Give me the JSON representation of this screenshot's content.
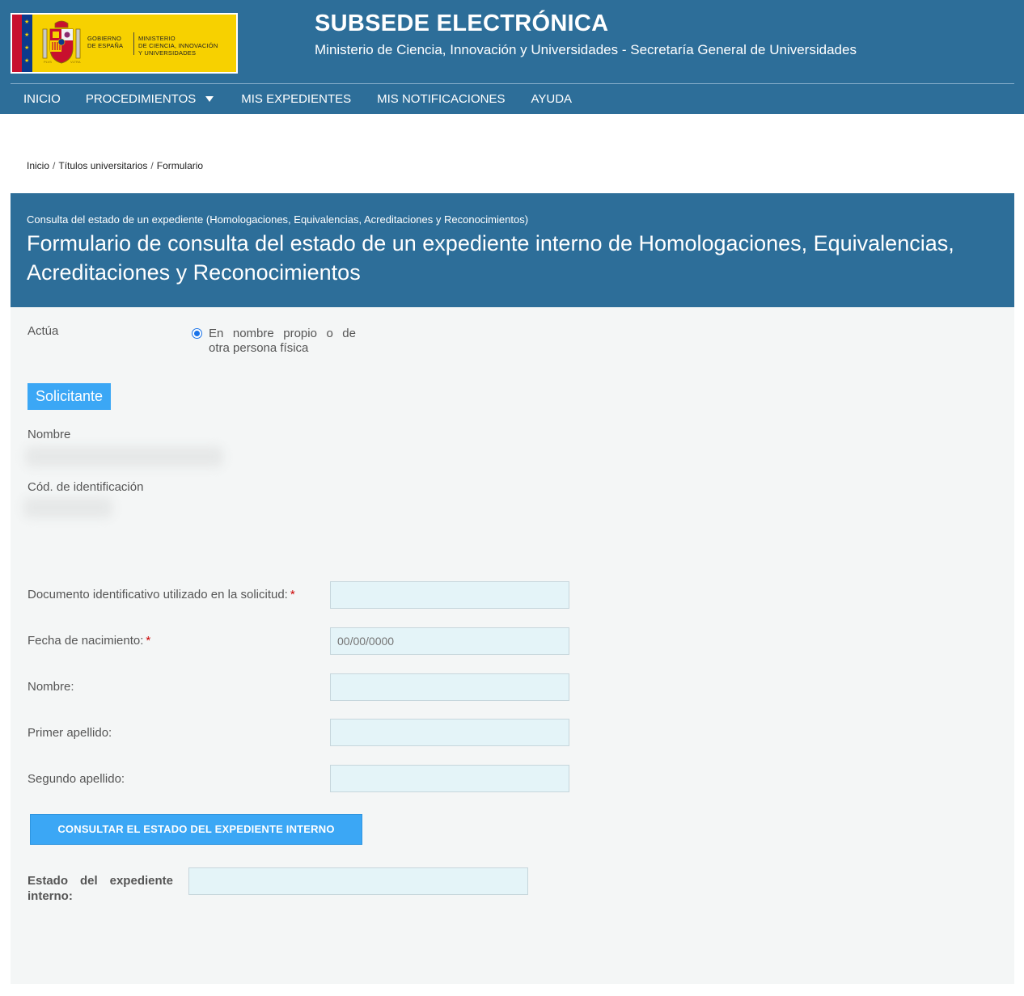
{
  "header": {
    "logo_left_text": [
      "GOBIERNO",
      "DE ESPAÑA"
    ],
    "logo_right_text": [
      "MINISTERIO",
      "DE CIENCIA, INNOVACIÓN",
      "Y UNIVERSIDADES"
    ],
    "title": "SUBSEDE ELECTRÓNICA",
    "subtitle": "Ministerio de Ciencia, Innovación y Universidades - Secretaría General de Universidades"
  },
  "nav": {
    "items": [
      {
        "label": "INICIO"
      },
      {
        "label": "PROCEDIMIENTOS",
        "dropdown": true
      },
      {
        "label": "MIS EXPEDIENTES"
      },
      {
        "label": "MIS NOTIFICACIONES"
      },
      {
        "label": "AYUDA"
      }
    ]
  },
  "breadcrumb": {
    "items": [
      "Inicio",
      "Títulos universitarios",
      "Formulario"
    ],
    "separator": "/"
  },
  "banner": {
    "small": "Consulta del estado de un expediente (Homologaciones, Equivalencias, Acreditaciones y Reconocimientos)",
    "title": "Formulario de consulta del estado de un expediente interno de Homologaciones, Equivalencias, Acreditaciones y Reconocimientos"
  },
  "form": {
    "actua_label": "Actúa",
    "actua_option": "En nombre propio o de otra persona física",
    "section_label": "Solicitante",
    "nombre_label": "Nombre",
    "cod_label": "Cód. de identificación",
    "fields": {
      "documento": {
        "label": "Documento identificativo utilizado en la solicitud:",
        "required_mark": "*",
        "value": ""
      },
      "fecha": {
        "label": "Fecha de nacimiento:",
        "required_mark": "*",
        "placeholder": "00/00/0000"
      },
      "nombre": {
        "label": "Nombre:",
        "value": ""
      },
      "primer_apellido": {
        "label": "Primer apellido:",
        "value": ""
      },
      "segundo_apellido": {
        "label": "Segundo apellido:",
        "value": ""
      }
    },
    "submit_label": "CONSULTAR EL ESTADO DEL EXPEDIENTE INTERNO",
    "estado_label": "Estado del expediente interno:",
    "estado_value": ""
  },
  "colors": {
    "header_bg": "#2d6e99",
    "accent_button": "#3ba7f5",
    "input_bg": "#e4f4f8",
    "panel_bg": "#f4f6f6",
    "required": "#cc0000"
  }
}
